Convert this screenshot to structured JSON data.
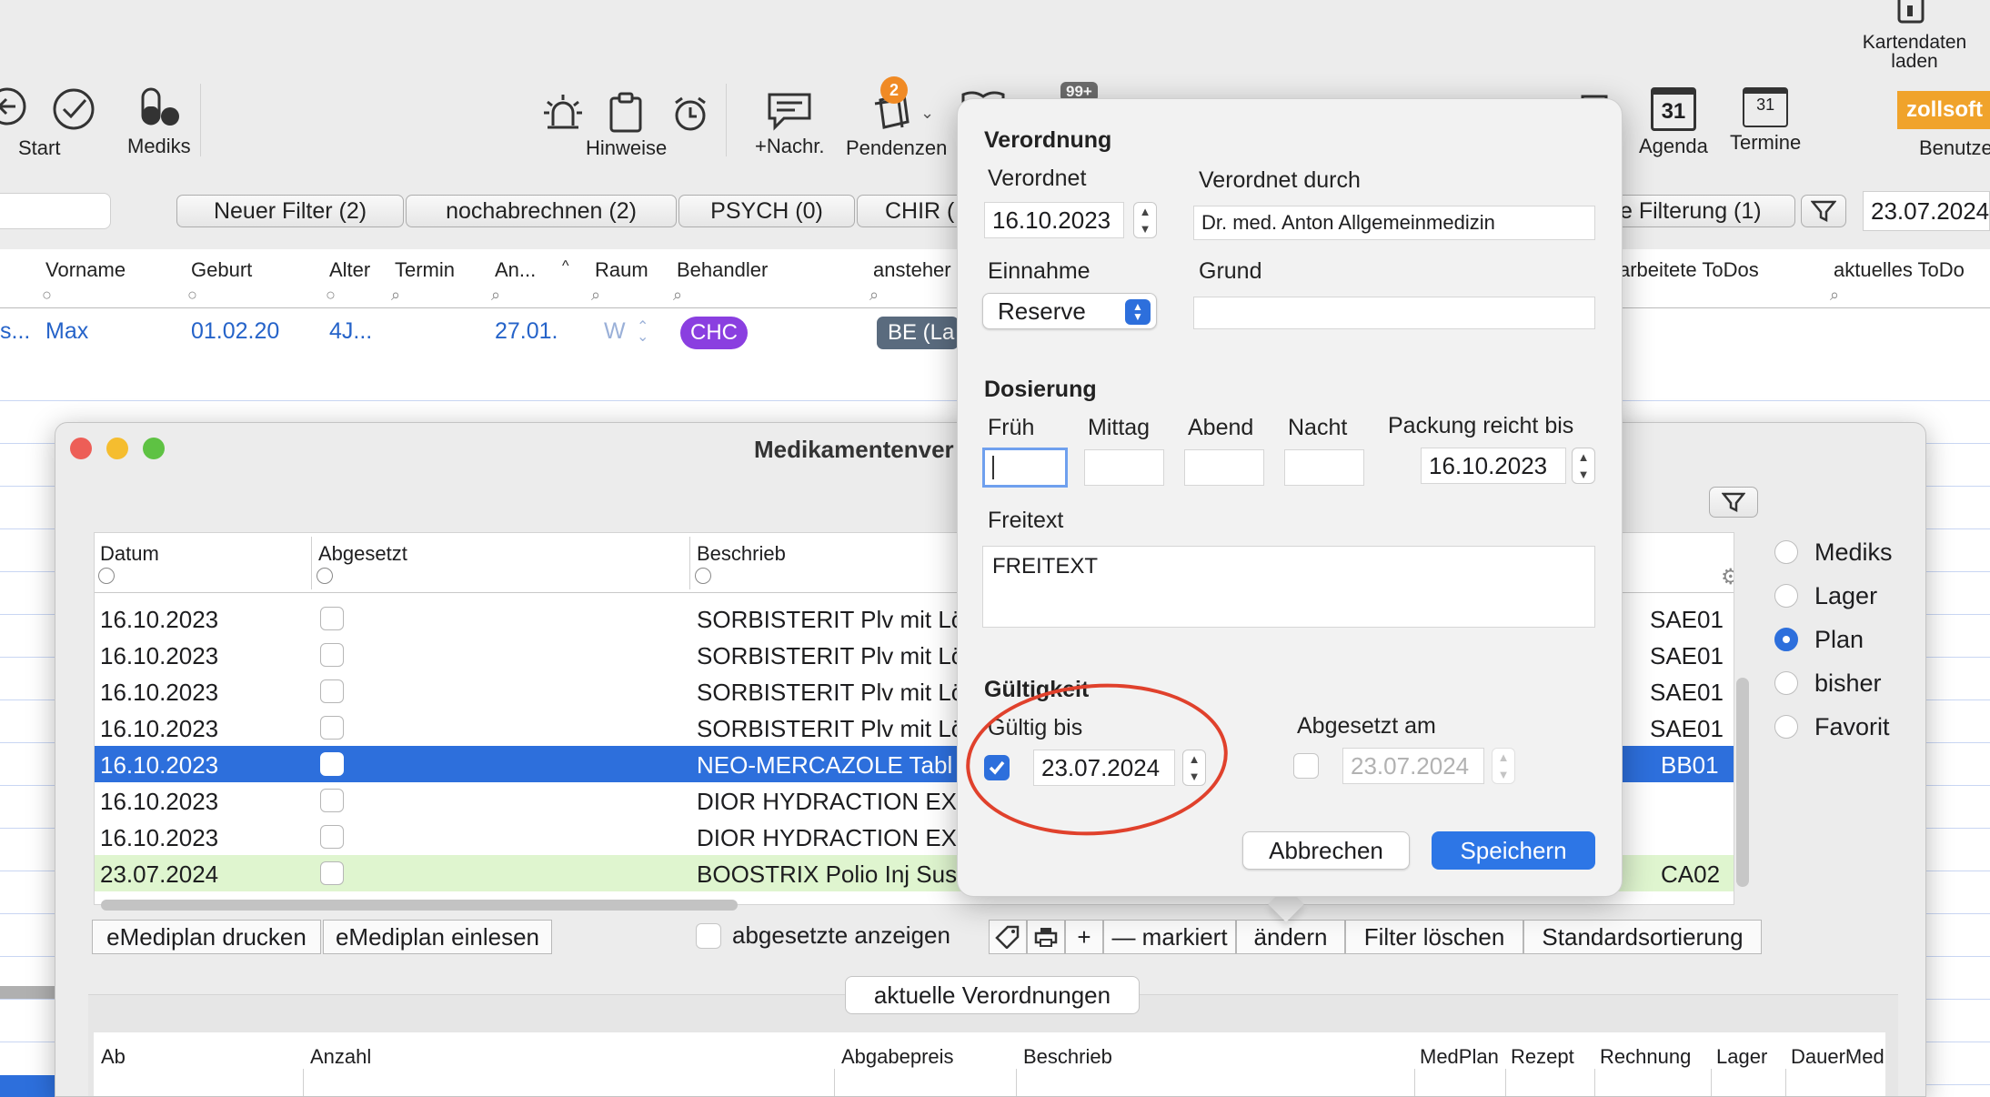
{
  "toolbar": {
    "start": "Start",
    "mediks": "Mediks",
    "hinweise": "Hinweise",
    "nachr": "+Nachr.",
    "pendenzen": "Pendenzen",
    "pendenzen_badge": "2",
    "msg_badge": "99+",
    "kartendaten": "Kartendaten\nladen",
    "agenda": "Agenda",
    "termine": "Termine",
    "calendar_day": "31",
    "brand": "zollsoft",
    "benutzer": "Benutzer"
  },
  "filters": {
    "buttons": [
      "Neuer Filter (2)",
      "nochabrechnen (2)",
      "PSYCH (0)",
      "CHIR ("
    ],
    "filterung": "e Filterung (1)",
    "date": "23.07.2024"
  },
  "patient_table": {
    "headers": [
      "Vorname",
      "Geburt",
      "Alter",
      "Termin",
      "An...",
      "Raum",
      "Behandler",
      "ansteher",
      "arbeitete ToDos",
      "aktuelles ToDo"
    ],
    "row": {
      "prefix": "s...",
      "vorname": "Max",
      "geburt": "01.02.20",
      "alter": "4J...",
      "an": "27.01.",
      "raum": "W",
      "behandler": "CHC",
      "ansteher": "BE (La"
    }
  },
  "med_window": {
    "title": "Medikamentenver",
    "headers": [
      "Datum",
      "Abgesetzt",
      "Beschrieb"
    ],
    "rows": [
      {
        "datum": "16.10.2023",
        "beschrieb": "SORBISTERIT Plv mit Lö",
        "code": "SAE01"
      },
      {
        "datum": "16.10.2023",
        "beschrieb": "SORBISTERIT Plv mit Lö",
        "code": "SAE01"
      },
      {
        "datum": "16.10.2023",
        "beschrieb": "SORBISTERIT Plv mit Lö",
        "code": "SAE01"
      },
      {
        "datum": "16.10.2023",
        "beschrieb": "SORBISTERIT Plv mit Lö",
        "code": "SAE01"
      },
      {
        "datum": "16.10.2023",
        "beschrieb": "NEO-MERCAZOLE Tabl",
        "code": "BB01"
      },
      {
        "datum": "16.10.2023",
        "beschrieb": "DIOR HYDRACTION EXF",
        "code": ""
      },
      {
        "datum": "16.10.2023",
        "beschrieb": "DIOR HYDRACTION EXF",
        "code": ""
      },
      {
        "datum": "23.07.2024",
        "beschrieb": "BOOSTRIX Polio Inj Susp",
        "code": "CA02"
      }
    ],
    "radios": [
      "Mediks",
      "Lager",
      "Plan",
      "bisher",
      "Favorit"
    ],
    "selected_radio": "Plan",
    "bottom": {
      "emediplan_drucken": "eMediplan drucken",
      "emediplan_einlesen": "eMediplan einlesen",
      "abgesetzte": "abgesetzte anzeigen",
      "markiert": "— markiert",
      "aendern": "ändern",
      "filter_loeschen": "Filter löschen",
      "standardsortierung": "Standardsortierung"
    },
    "aktuelle": "aktuelle Verordnungen",
    "lower_headers": [
      "Ab",
      "Anzahl",
      "Abgabepreis",
      "Beschrieb",
      "MedPlan",
      "Rezept",
      "Rechnung",
      "Lager",
      "DauerMed"
    ]
  },
  "popover": {
    "verordnung": "Verordnung",
    "verordnet_label": "Verordnet",
    "verordnet_value": "16.10.2023",
    "verordnet_durch_label": "Verordnet durch",
    "verordnet_durch_value": "Dr. med. Anton Allgemeinmedizin",
    "einnahme_label": "Einnahme",
    "einnahme_value": "Reserve",
    "grund_label": "Grund",
    "grund_value": "",
    "dosierung": "Dosierung",
    "frueh": "Früh",
    "mittag": "Mittag",
    "abend": "Abend",
    "nacht": "Nacht",
    "packung_label": "Packung reicht bis",
    "packung_value": "16.10.2023",
    "freitext_label": "Freitext",
    "freitext_value": "FREITEXT",
    "gueltigkeit": "Gültigkeit",
    "gueltig_bis_label": "Gültig bis",
    "gueltig_bis_value": "23.07.2024",
    "gueltig_checked": true,
    "abgesetzt_am_label": "Abgesetzt am",
    "abgesetzt_am_value": "23.07.2024",
    "abgesetzt_checked": false,
    "abbrechen": "Abbrechen",
    "speichern": "Speichern"
  },
  "colors": {
    "accent": "#2d6fdc",
    "highlight_circle": "#e0412c",
    "brand": "#f0a32b",
    "behandler_pill": "#8a3fe0",
    "green_row": "#dff5cf"
  }
}
